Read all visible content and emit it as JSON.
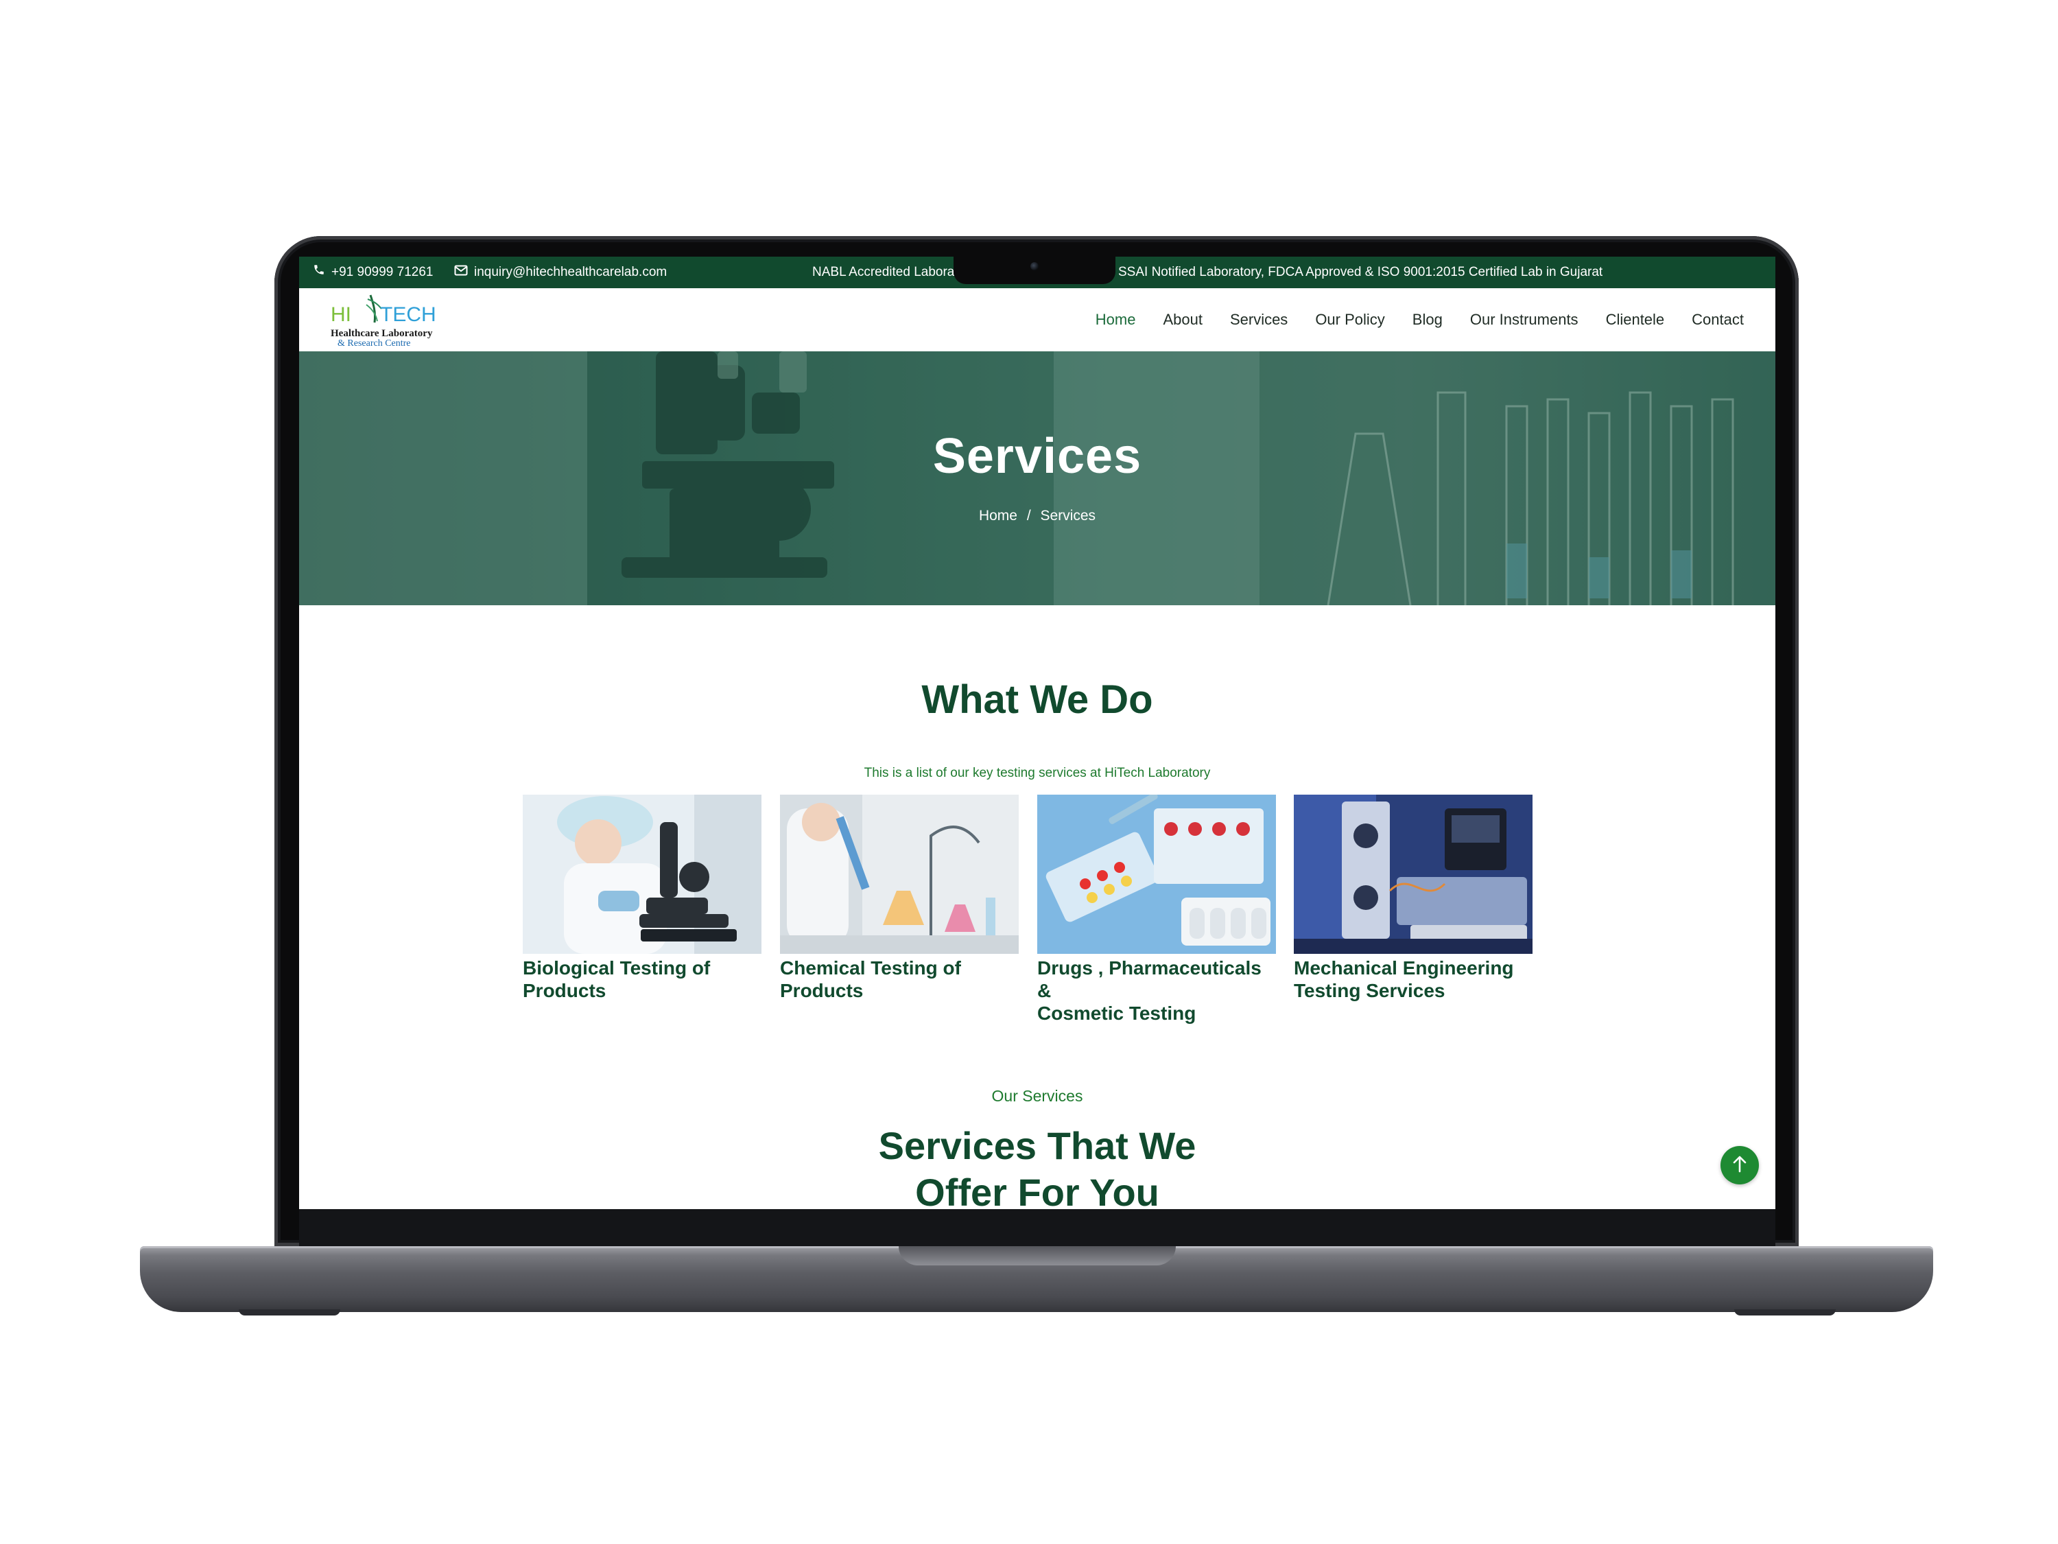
{
  "topbar": {
    "phone": "+91 90999 71261",
    "email": "inquiry@hitechhealthcarelab.com",
    "ticker_left": "NABL Accredited Labora",
    "ticker_right": "SSAI Notified Laboratory, FDCA Approved & ISO 9001:2015 Certified Lab in Gujarat",
    "phone_icon": "phone-icon",
    "mail_icon": "envelope-icon"
  },
  "logo": {
    "brand_hi": "HI",
    "brand_tech": "TECH",
    "line1": "Healthcare Laboratory",
    "line2": "& Research Centre"
  },
  "nav": {
    "items": [
      {
        "label": "Home",
        "active": true
      },
      {
        "label": "About"
      },
      {
        "label": "Services"
      },
      {
        "label": "Our Policy"
      },
      {
        "label": "Blog"
      },
      {
        "label": "Our Instruments"
      },
      {
        "label": "Clientele"
      },
      {
        "label": "Contact"
      }
    ]
  },
  "hero": {
    "title": "Services",
    "breadcrumb_home": "Home",
    "breadcrumb_sep": "/",
    "breadcrumb_current": "Services"
  },
  "what_we_do": {
    "title": "What We Do",
    "subtitle": "This is a list of our key testing services at HiTech Laboratory",
    "cards": [
      {
        "line1": "Biological Testing of",
        "line2": "Products"
      },
      {
        "line1": "Chemical Testing of",
        "line2": "Products"
      },
      {
        "line1": "Drugs , Pharmaceuticals &",
        "line2": "Cosmetic Testing"
      },
      {
        "line1": "Mechanical Engineering",
        "line2": "Testing Services"
      }
    ]
  },
  "our_services": {
    "kicker": "Our Services",
    "title_line1": "Services That We",
    "title_line2": "Offer For You"
  },
  "colors": {
    "brand_dark_green": "#114a2e",
    "accent_green": "#1e7a2e",
    "scroll_button": "#1e8a32"
  },
  "icons": {
    "scroll_top": "arrow-up-icon"
  }
}
